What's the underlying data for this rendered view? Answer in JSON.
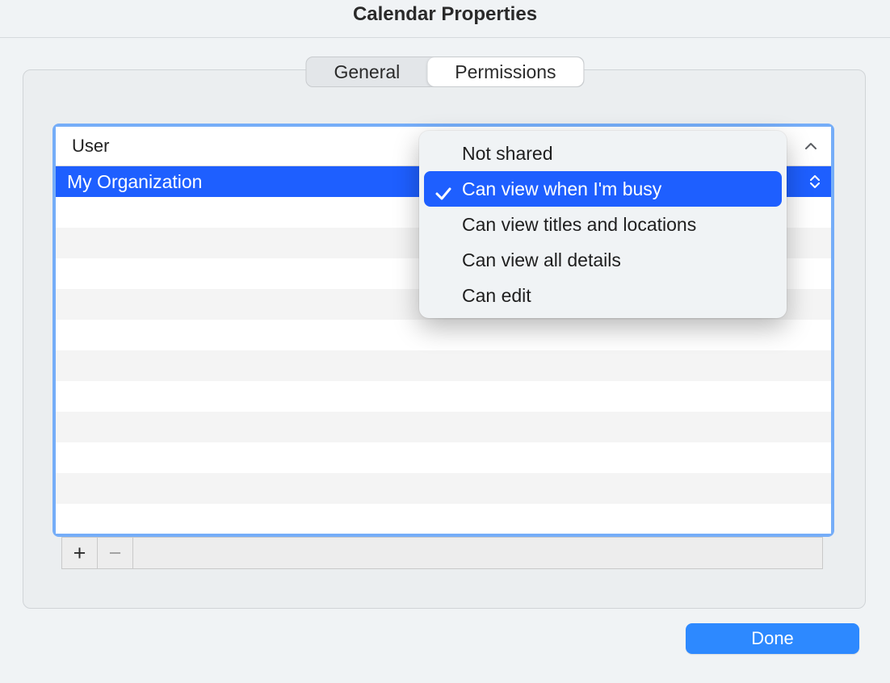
{
  "window": {
    "title": "Calendar Properties"
  },
  "tabs": {
    "general": "General",
    "permissions": "Permissions",
    "active": "permissions"
  },
  "table": {
    "header": "User",
    "rows": [
      {
        "user": "My Organization"
      }
    ],
    "selected_index": 0
  },
  "dropdown": {
    "options": [
      "Not shared",
      "Can view when I'm busy",
      "Can view titles and locations",
      "Can view all details",
      "Can edit"
    ],
    "selected_index": 1
  },
  "footer": {
    "add_label": "+",
    "remove_label": "−",
    "remove_enabled": false
  },
  "done_button": "Done",
  "colors": {
    "accent_blue": "#1e5fff",
    "button_blue": "#2d89ff"
  }
}
